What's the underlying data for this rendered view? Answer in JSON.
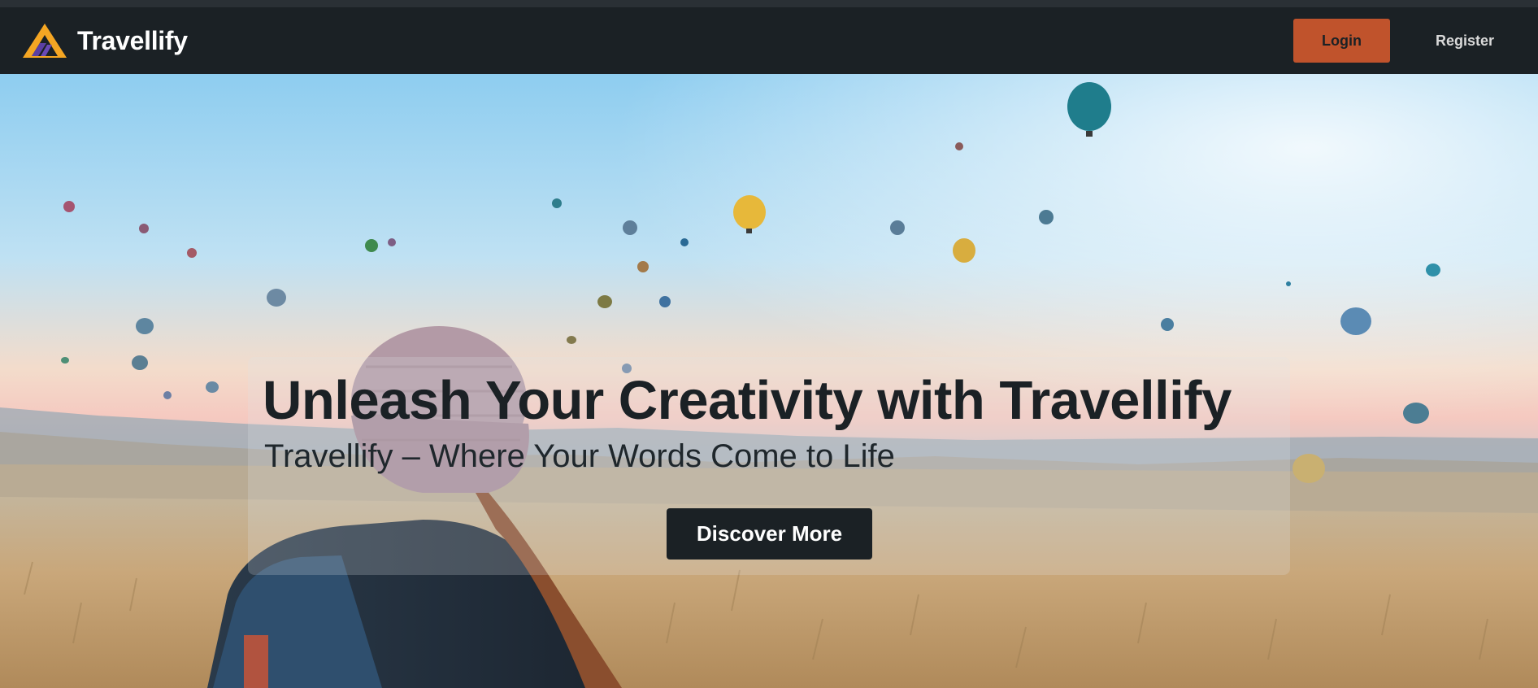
{
  "brand": {
    "name": "Travellify",
    "logo_icon": "triangle-mountain-logo-icon",
    "logo_colors": {
      "outer": "#f5a623",
      "inner": "#5b3fa3",
      "accent": "#2a1f6b"
    }
  },
  "nav": {
    "login_label": "Login",
    "register_label": "Register"
  },
  "hero": {
    "headline": "Unleash Your Creativity with Travellify",
    "subheadline": "Travellify – Where Your Words Come to Life",
    "cta_label": "Discover More",
    "background_image": "hot-air-balloons-traveler-photo"
  },
  "colors": {
    "navbar": "#1b2125",
    "login_button": "#c0532c",
    "cta_button": "#1b2125",
    "text_dark": "#1b2125"
  }
}
